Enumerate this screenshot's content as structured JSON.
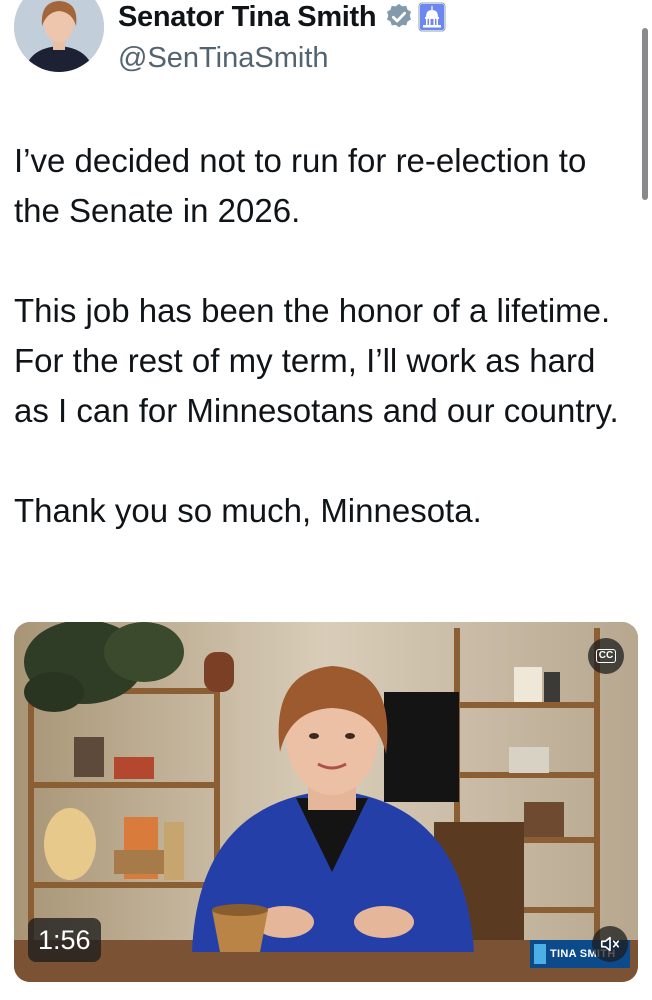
{
  "profile": {
    "display_name": "Senator Tina Smith",
    "handle": "@SenTinaSmith",
    "verified_icon": "gray-verified-check-icon",
    "affiliate_icon": "us-capitol-badge-icon"
  },
  "tweet": {
    "paragraphs": [
      "I’ve decided not to run for re-election to the Senate in 2026.",
      "This job has been the honor of a lifetime. For the rest of my term, I’ll work as hard as I can for Minnesotans and our country.",
      "Thank you so much, Minnesota."
    ]
  },
  "video": {
    "duration": "1:56",
    "captions_label": "CC",
    "logo_text": "TINA SMITH",
    "colors": {
      "jacket": "#2440a8",
      "overlay": "#1e1e1e"
    }
  }
}
